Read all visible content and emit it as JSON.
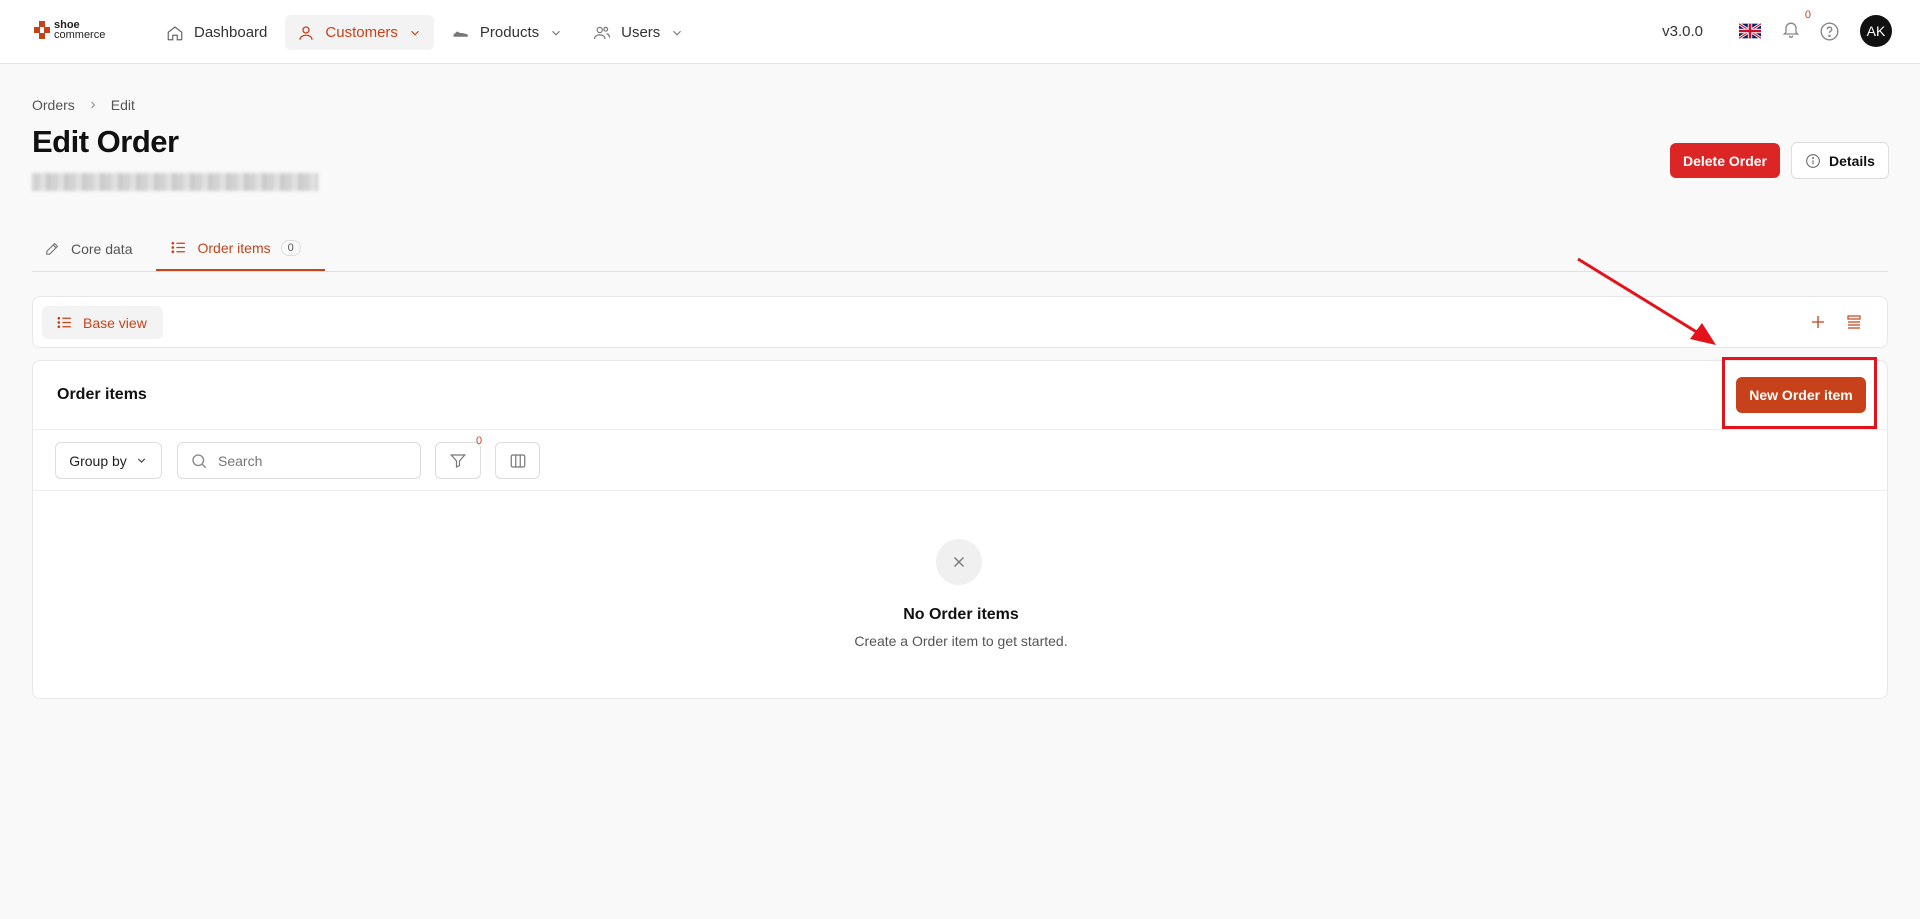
{
  "brand": {
    "line1": "shoe",
    "line2": "commerce"
  },
  "nav": {
    "items": [
      {
        "label": "Dashboard",
        "icon": "home-icon"
      },
      {
        "label": "Customers",
        "icon": "user-icon"
      },
      {
        "label": "Products",
        "icon": "shoe-icon"
      },
      {
        "label": "Users",
        "icon": "users-icon"
      }
    ],
    "active": "Customers"
  },
  "header_right": {
    "version": "v3.0.0",
    "notification_count": "0",
    "avatar_initials": "AK"
  },
  "breadcrumb": {
    "items": [
      "Orders",
      "Edit"
    ]
  },
  "page": {
    "title": "Edit Order"
  },
  "actions": {
    "delete_label": "Delete Order",
    "details_label": "Details"
  },
  "tabs": [
    {
      "label": "Core data"
    },
    {
      "label": "Order items",
      "count": "0"
    }
  ],
  "viewbar": {
    "base_view_label": "Base view"
  },
  "panel": {
    "title": "Order items",
    "new_button_label": "New Order item",
    "group_by_label": "Group by",
    "search_placeholder": "Search",
    "filter_count": "0",
    "empty_title": "No Order items",
    "empty_subtitle": "Create a Order item to get started."
  },
  "colors": {
    "accent": "#c7421a",
    "danger": "#dc2626",
    "annotation": "#e3121b"
  }
}
